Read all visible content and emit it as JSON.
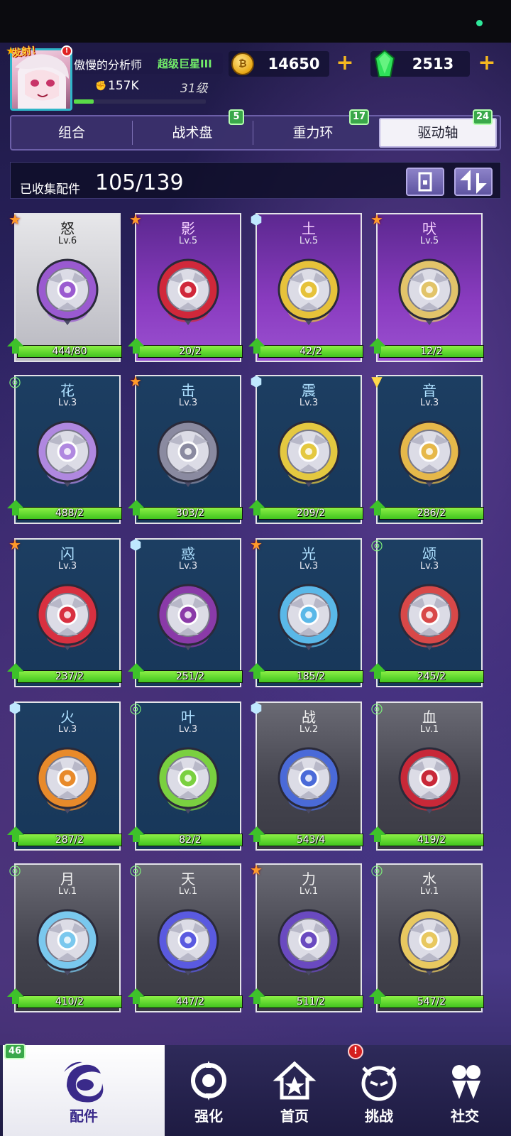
{
  "header": {
    "avatar_tag": "发射！",
    "player_name": "傲慢的分析师",
    "player_rank": "超级巨星III",
    "power": "157K",
    "level": "31级",
    "exp_fraction": 0.15,
    "coins": "14650",
    "gems": "2513"
  },
  "tabs": [
    {
      "label": "组合",
      "badge": ""
    },
    {
      "label": "战术盘",
      "badge": "5"
    },
    {
      "label": "重力环",
      "badge": "17"
    },
    {
      "label": "驱动轴",
      "badge": "24",
      "active": true
    }
  ],
  "collection": {
    "label": "已收集配件",
    "value": "105/139"
  },
  "parts": [
    {
      "name": "怒",
      "level": "Lv.6",
      "progress": "444/80",
      "fill": 1.0,
      "type": "attack",
      "tier": "silver",
      "color": "#9a5ad0"
    },
    {
      "name": "影",
      "level": "Lv.5",
      "progress": "20/2",
      "fill": 1.0,
      "type": "attack",
      "tier": "purple",
      "color": "#d0283a"
    },
    {
      "name": "土",
      "level": "Lv.5",
      "progress": "42/2",
      "fill": 1.0,
      "type": "defense",
      "tier": "purple",
      "color": "#e6c23a"
    },
    {
      "name": "吠",
      "level": "Lv.5",
      "progress": "12/2",
      "fill": 1.0,
      "type": "attack",
      "tier": "purple",
      "color": "#e2c46a"
    },
    {
      "name": "花",
      "level": "Lv.3",
      "progress": "488/2",
      "fill": 1.0,
      "type": "stamina",
      "tier": "blue",
      "color": "#b088e0"
    },
    {
      "name": "击",
      "level": "Lv.3",
      "progress": "303/2",
      "fill": 1.0,
      "type": "attack",
      "tier": "blue",
      "color": "#8a8aa0"
    },
    {
      "name": "震",
      "level": "Lv.3",
      "progress": "209/2",
      "fill": 1.0,
      "type": "defense",
      "tier": "blue",
      "color": "#e4c840"
    },
    {
      "name": "音",
      "level": "Lv.3",
      "progress": "286/2",
      "fill": 1.0,
      "type": "balance",
      "tier": "blue",
      "color": "#e6b84a"
    },
    {
      "name": "闪",
      "level": "Lv.3",
      "progress": "237/2",
      "fill": 1.0,
      "type": "attack",
      "tier": "blue",
      "color": "#d83040"
    },
    {
      "name": "惑",
      "level": "Lv.3",
      "progress": "251/2",
      "fill": 1.0,
      "type": "defense",
      "tier": "blue",
      "color": "#8a3aa8"
    },
    {
      "name": "光",
      "level": "Lv.3",
      "progress": "185/2",
      "fill": 1.0,
      "type": "attack",
      "tier": "blue",
      "color": "#5ab8e8"
    },
    {
      "name": "颂",
      "level": "Lv.3",
      "progress": "245/2",
      "fill": 1.0,
      "type": "stamina",
      "tier": "blue",
      "color": "#d84848"
    },
    {
      "name": "火",
      "level": "Lv.3",
      "progress": "287/2",
      "fill": 1.0,
      "type": "defense",
      "tier": "blue",
      "color": "#e88a2a"
    },
    {
      "name": "叶",
      "level": "Lv.3",
      "progress": "82/2",
      "fill": 1.0,
      "type": "stamina",
      "tier": "blue",
      "color": "#7ad040"
    },
    {
      "name": "战",
      "level": "Lv.2",
      "progress": "543/4",
      "fill": 1.0,
      "type": "defense",
      "tier": "gray",
      "color": "#4a6ad8"
    },
    {
      "name": "血",
      "level": "Lv.1",
      "progress": "419/2",
      "fill": 1.0,
      "type": "stamina",
      "tier": "gray",
      "color": "#c82838"
    },
    {
      "name": "月",
      "level": "Lv.1",
      "progress": "410/2",
      "fill": 1.0,
      "type": "stamina",
      "tier": "gray",
      "color": "#7ac8ee"
    },
    {
      "name": "天",
      "level": "Lv.1",
      "progress": "447/2",
      "fill": 1.0,
      "type": "stamina",
      "tier": "gray",
      "color": "#5a5ae0"
    },
    {
      "name": "力",
      "level": "Lv.1",
      "progress": "511/2",
      "fill": 1.0,
      "type": "attack",
      "tier": "gray",
      "color": "#6a4ac0"
    },
    {
      "name": "水",
      "level": "Lv.1",
      "progress": "547/2",
      "fill": 1.0,
      "type": "stamina",
      "tier": "gray",
      "color": "#e8c860"
    }
  ],
  "nav": [
    {
      "label": "配件",
      "icon": "parts-icon",
      "active": true
    },
    {
      "label": "强化",
      "icon": "upgrade-icon"
    },
    {
      "label": "首页",
      "icon": "home-icon"
    },
    {
      "label": "挑战",
      "icon": "challenge-icon"
    },
    {
      "label": "社交",
      "icon": "social-icon"
    }
  ],
  "nav_badge": "46",
  "nav_alert": "!",
  "colors": {
    "accent_green": "#41c41e",
    "gold": "#f5b820"
  }
}
